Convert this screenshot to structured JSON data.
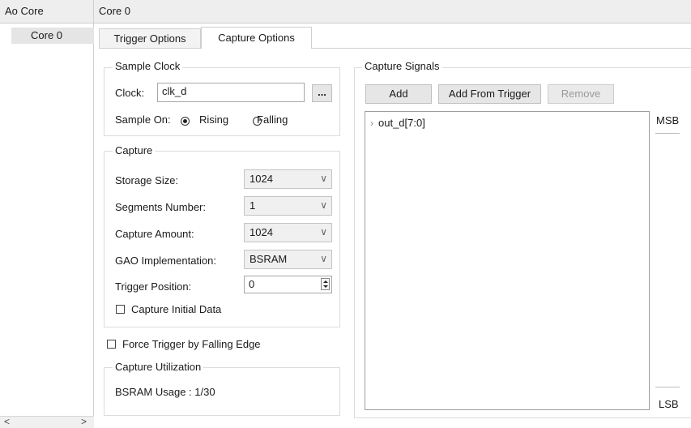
{
  "header": {
    "left_title": "Ao Core",
    "right_title": "Core 0"
  },
  "tree": {
    "items": [
      {
        "label": "Core 0"
      }
    ]
  },
  "tabs": [
    {
      "label": "Trigger Options"
    },
    {
      "label": "Capture Options"
    }
  ],
  "sample_clock": {
    "legend": "Sample Clock",
    "clock_label": "Clock:",
    "clock_value": "clk_d",
    "browse_label": "...",
    "sample_on_label": "Sample On:",
    "rising_label": "Rising",
    "falling_label": "Falling"
  },
  "capture": {
    "legend": "Capture",
    "storage_size_label": "Storage Size:",
    "storage_size_value": "1024",
    "segments_label": "Segments Number:",
    "segments_value": "1",
    "amount_label": "Capture Amount:",
    "amount_value": "1024",
    "gao_label": "GAO Implementation:",
    "gao_value": "BSRAM",
    "trigger_pos_label": "Trigger Position:",
    "trigger_pos_value": "0",
    "initial_data_label": "Capture Initial Data"
  },
  "force_trigger_label": "Force Trigger by Falling Edge",
  "utilization": {
    "legend": "Capture Utilization",
    "bsram_usage": "BSRAM Usage : 1/30"
  },
  "signals": {
    "legend": "Capture Signals",
    "add_label": "Add",
    "add_from_trigger_label": "Add From Trigger",
    "remove_label": "Remove",
    "items": [
      {
        "label": "out_d[7:0]"
      }
    ],
    "msb_label": "MSB",
    "lsb_label": "LSB"
  },
  "scroll": {
    "left_arrow": "<",
    "right_arrow": ">"
  }
}
